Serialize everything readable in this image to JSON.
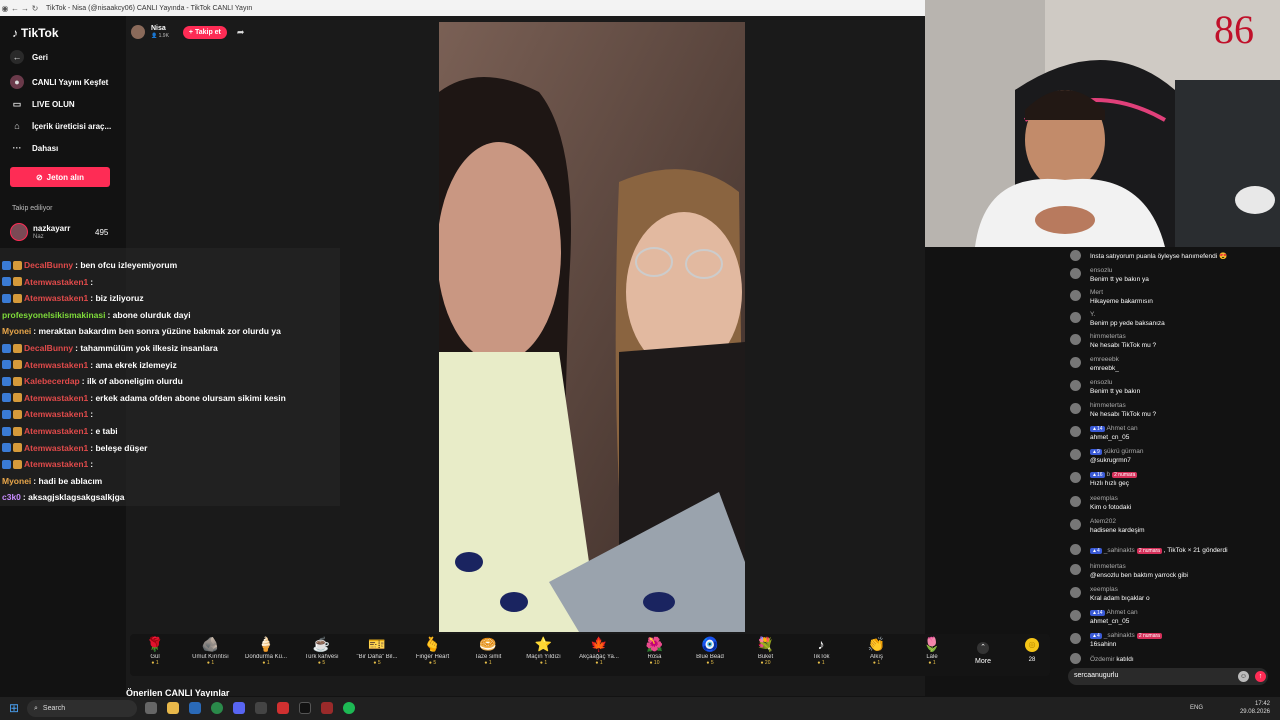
{
  "browser": {
    "title": "TikTok - Nisa (@nisaakcy06) CANLI Yayında - TikTok CANLI Yayın"
  },
  "sidebar": {
    "logo": "TikTok",
    "items": [
      {
        "label": "Geri",
        "icon": "back-arrow-icon"
      },
      {
        "label": "CANLI Yayını Keşfet",
        "icon": "live-explore-icon"
      },
      {
        "label": "LIVE OLUN",
        "icon": "camera-icon"
      },
      {
        "label": "İçerik üreticisi araç...",
        "icon": "creator-tools-icon"
      },
      {
        "label": "Dahası",
        "icon": "more-dots-icon"
      }
    ],
    "jeton_label": "Jeton alın",
    "following_heading": "Takip ediliyor",
    "following": [
      {
        "name": "nazkayarr",
        "sub": "Naz",
        "count": "495"
      }
    ]
  },
  "stream": {
    "host_name": "Nisa",
    "host_viewers": "1.9K",
    "follow_label": "+ Takip et"
  },
  "overlay_chat": [
    {
      "user": "DecalBunny",
      "msg": ": ben ofcu izleyemiyorum",
      "color": "red"
    },
    {
      "user": "Atemwastaken1",
      "msg": ":",
      "color": "red"
    },
    {
      "user": "Atemwastaken1",
      "msg": ": biz izliyoruz",
      "color": "red"
    },
    {
      "user": "profesyonelsikismakinasi",
      "msg": ": abone olurduk dayi",
      "color": "green"
    },
    {
      "user": "Myonei",
      "msg": ": meraktan bakardım ben sonra yüzüne bakmak zor olurdu ya",
      "color": "orange"
    },
    {
      "user": "DecalBunny",
      "msg": ": tahammülüm yok ilkesiz insanlara",
      "color": "red"
    },
    {
      "user": "Atemwastaken1",
      "msg": ": ama ekrek izlemeyiz",
      "color": "red"
    },
    {
      "user": "Kalebecerdap",
      "msg": ": ilk of aboneligim olurdu",
      "color": "red"
    },
    {
      "user": "Atemwastaken1",
      "msg": ": erkek adama ofden abone olursam sikimi kesin",
      "color": "red"
    },
    {
      "user": "Atemwastaken1",
      "msg": ":",
      "color": "red"
    },
    {
      "user": "Atemwastaken1",
      "msg": ": e tabi",
      "color": "red"
    },
    {
      "user": "Atemwastaken1",
      "msg": ": beleşe düşer",
      "color": "red"
    },
    {
      "user": "Atemwastaken1",
      "msg": ":",
      "color": "red"
    },
    {
      "user": "Myonei",
      "msg": ": hadi be ablacım",
      "color": "orange"
    },
    {
      "user": "c3k0",
      "msg": ": aksagjsklagsakgsalkjga",
      "color": "purple"
    }
  ],
  "gifts": [
    {
      "label": "Gül",
      "price": "1",
      "icon": "🌹"
    },
    {
      "label": "Umut Kırıntısı",
      "price": "1",
      "icon": "🪨"
    },
    {
      "label": "Dondurma Kü...",
      "price": "1",
      "icon": "🍦"
    },
    {
      "label": "Türk kahvesi",
      "price": "5",
      "icon": "☕"
    },
    {
      "label": "\"Bir Daha\" Bil...",
      "price": "5",
      "icon": "🎫"
    },
    {
      "label": "Finger Heart",
      "price": "5",
      "icon": "🫰"
    },
    {
      "label": "Taze simit",
      "price": "1",
      "icon": "🥯"
    },
    {
      "label": "Maçın Yıldızı",
      "price": "1",
      "icon": "⭐"
    },
    {
      "label": "Akçaağaç Ya...",
      "price": "1",
      "icon": "🍁"
    },
    {
      "label": "Rosa",
      "price": "10",
      "icon": "🌺"
    },
    {
      "label": "Blue Bead",
      "price": "5",
      "icon": "🧿"
    },
    {
      "label": "Buket",
      "price": "20",
      "icon": "💐"
    },
    {
      "label": "TikTok",
      "price": "1",
      "icon": "♪"
    },
    {
      "label": "Alkış",
      "price": "1",
      "icon": "👏"
    },
    {
      "label": "Lale",
      "price": "1",
      "icon": "🌷"
    }
  ],
  "more_label": "More",
  "coins": "28",
  "recommended_heading": "Önerilen CANLI Yayınlar",
  "webcam_counter": "86",
  "chat": [
    {
      "user": "",
      "text": "Insta satıyorum puanla öyleyse hanımefendi 😍"
    },
    {
      "user": "ensozlu",
      "text": "Benim tt ye bakın ya"
    },
    {
      "user": "Mert",
      "text": "Hikayeme bakarmısın"
    },
    {
      "user": "Y.",
      "text": "Benim pp yede baksanıza"
    },
    {
      "user": "himmetertas",
      "text": "Ne hesabı TikTok mu ?"
    },
    {
      "user": "emreeebk",
      "text": "emreebk_"
    },
    {
      "user": "ensozlu",
      "text": "Benim tt ye bakın"
    },
    {
      "user": "himmetertas",
      "text": "Ne hesabı TikTok mu ?"
    },
    {
      "user": "Ahmet can",
      "level": "14",
      "text": "ahmet_cn_05"
    },
    {
      "user": "şükrü gürman",
      "level": "9",
      "text": "@sukrugrmn7"
    },
    {
      "user": "b",
      "level": "16",
      "rank": "2 numara",
      "text": "Hızlı hızlı geç"
    },
    {
      "user": "xeemplas",
      "text": "Kim o fotodaki"
    },
    {
      "user": "Atem202",
      "text": "hadisene kardeşim"
    },
    {
      "user": "_sahinakts",
      "level": "4",
      "rank": "2 numara",
      "text": ", TikTok × 21 gönderdi",
      "inline": true
    },
    {
      "user": "himmetertas",
      "text": "@ensozlu ben baktım yarrock gibi"
    },
    {
      "user": "xeemplas",
      "text": "Kral adam bıçaklar o"
    },
    {
      "user": "Ahmet can",
      "level": "14",
      "text": "ahmet_cn_05"
    },
    {
      "user": "_sahinakts",
      "level": "4",
      "rank": "2 numara",
      "text": "16sahinn"
    },
    {
      "user": "Özdemir",
      "text": "katıldı",
      "inline": true
    }
  ],
  "chat_input_value": "sercaanugurlu",
  "taskbar": {
    "search_placeholder": "Search",
    "lang": "ENG",
    "time": "17:42",
    "date": "29.08.2026"
  }
}
